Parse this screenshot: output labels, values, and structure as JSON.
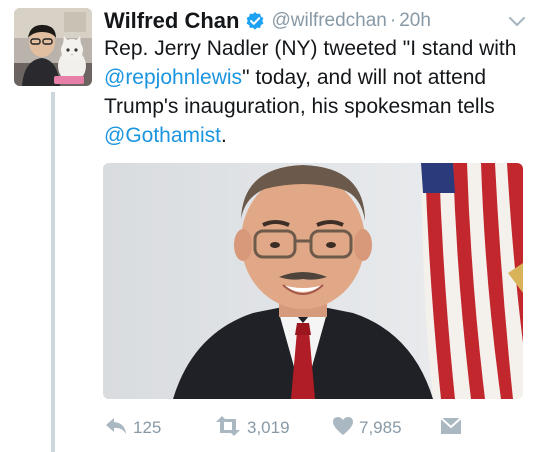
{
  "tweet": {
    "author": {
      "display_name": "Wilfred Chan",
      "handle": "@wilfredchan",
      "verified": true,
      "avatar": "avatar-photo"
    },
    "separator": "·",
    "timestamp": "20h",
    "text_parts": [
      {
        "type": "text",
        "value": "Rep. Jerry Nadler (NY) tweeted \"I stand with "
      },
      {
        "type": "mention",
        "value": "@repjohnlewis"
      },
      {
        "type": "text",
        "value": "\" today, and will not attend Trump's inauguration, his spokesman tells "
      },
      {
        "type": "mention",
        "value": "@Gothamist"
      },
      {
        "type": "text",
        "value": "."
      }
    ],
    "media": {
      "kind": "photo",
      "subject": "portrait-photo"
    },
    "actions": {
      "reply": {
        "icon": "reply-icon",
        "count": "125"
      },
      "retweet": {
        "icon": "retweet-icon",
        "count": "3,019"
      },
      "like": {
        "icon": "heart-icon",
        "count": "7,985"
      },
      "dm": {
        "icon": "envelope-icon"
      }
    },
    "menu_icon": "chevron-down-icon"
  },
  "colors": {
    "text": "#14171a",
    "secondary": "#8899a6",
    "link": "#1b95e0",
    "verified": "#1da1f2",
    "thread_line": "#ccd6dd"
  }
}
